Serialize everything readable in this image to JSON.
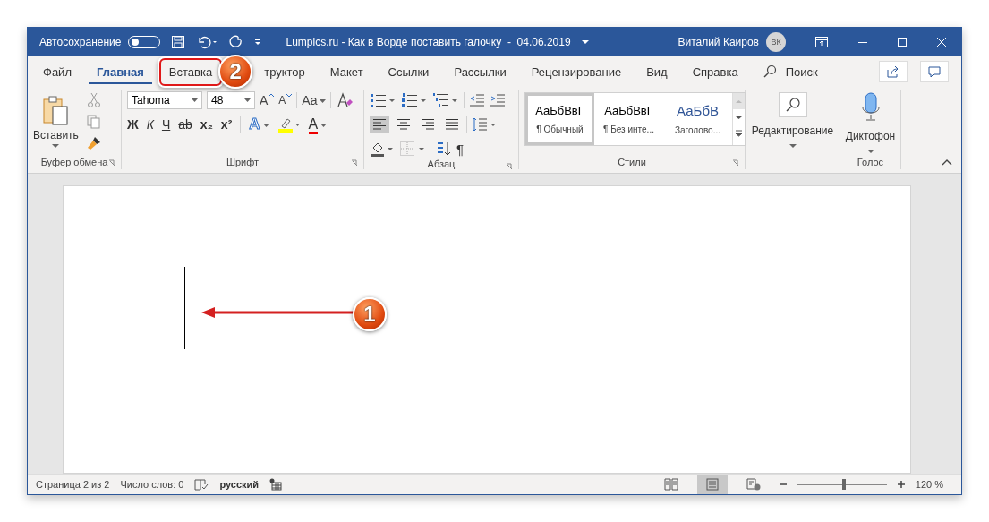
{
  "title_bar": {
    "autosave_label": "Автосохранение",
    "autosave_on": false,
    "title": "Lumpics.ru - Как в Ворде поставить галочку  -  04.06.2019",
    "user": "Виталий Каиров",
    "avatar": "ВК"
  },
  "tabs": [
    {
      "label": "Файл",
      "selected": false,
      "highlighted": false
    },
    {
      "label": "Главная",
      "selected": true,
      "highlighted": false
    },
    {
      "label": "Вставка",
      "selected": false,
      "highlighted": true,
      "badge": "2"
    },
    {
      "label": "труктор",
      "selected": false,
      "highlighted": false
    },
    {
      "label": "Макет",
      "selected": false,
      "highlighted": false
    },
    {
      "label": "Ссылки",
      "selected": false,
      "highlighted": false
    },
    {
      "label": "Рассылки",
      "selected": false,
      "highlighted": false
    },
    {
      "label": "Рецензирование",
      "selected": false,
      "highlighted": false
    },
    {
      "label": "Вид",
      "selected": false,
      "highlighted": false
    },
    {
      "label": "Справка",
      "selected": false,
      "highlighted": false
    }
  ],
  "search": {
    "placeholder": "Поиск"
  },
  "clipboard": {
    "paste": "Вставить",
    "label": "Буфер обмена"
  },
  "font": {
    "name": "Tahoma",
    "size": "48",
    "grow": "A",
    "shrink": "A",
    "case": "Aa",
    "format": [
      "Ж",
      "К",
      "Ч",
      "ab",
      "x₂",
      "x²"
    ],
    "effects": "A",
    "color_letter": "A",
    "label": "Шрифт"
  },
  "paragraph": {
    "alignment": [
      {
        "kind": "left",
        "selected": true
      },
      {
        "kind": "center",
        "selected": false
      },
      {
        "kind": "right",
        "selected": false
      },
      {
        "kind": "justify",
        "selected": false
      }
    ],
    "pilcrow": "¶",
    "label": "Абзац"
  },
  "styles": {
    "items": [
      {
        "preview": "АаБбВвГ",
        "name": "¶ Обычный",
        "selected": true,
        "kind": "normal"
      },
      {
        "preview": "АаБбВвГ",
        "name": "¶ Без инте...",
        "selected": false,
        "kind": "normal"
      },
      {
        "preview": "АаБбВ",
        "name": "Заголово...",
        "selected": false,
        "kind": "heading"
      }
    ],
    "label": "Стили"
  },
  "editing": {
    "label": "Редактирование"
  },
  "voice": {
    "button": "Диктофон",
    "label": "Голос"
  },
  "document": {
    "annotation": "1"
  },
  "status_bar": {
    "page": "Страница 2 из 2",
    "words": "Число слов: 0",
    "language": "русский",
    "views": [
      {
        "kind": "read",
        "selected": false
      },
      {
        "kind": "print",
        "selected": true
      },
      {
        "kind": "web",
        "selected": false
      }
    ],
    "zoom": {
      "level": 0.52,
      "reading": "120 %"
    }
  }
}
